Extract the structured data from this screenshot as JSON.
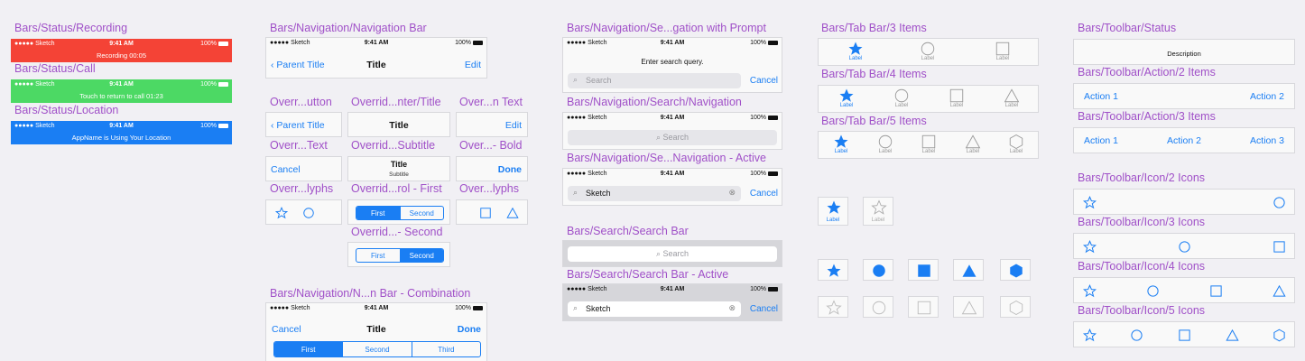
{
  "colors": {
    "label_purple": "#a050c8",
    "ios_blue": "#1a7ef3",
    "recording_red": "#f44336",
    "call_green": "#4cd964",
    "location_blue": "#1a7ef3"
  },
  "statusbar": {
    "carrier": "●●●●● Sketch",
    "time": "9:41 AM",
    "battery": "100%"
  },
  "col1": {
    "recording_label": "Bars/Status/Recording",
    "recording_text": "Recording  00:05",
    "call_label": "Bars/Status/Call",
    "call_text": "Touch to return to call  01:23",
    "location_label": "Bars/Status/Location",
    "location_text": "AppName is Using Your Location"
  },
  "col2": {
    "navbar_label": "Bars/Navigation/Navigation Bar",
    "parent_title": "Parent Title",
    "title": "Title",
    "edit": "Edit",
    "ov_button_label": "Overr...utton",
    "ov_center_label": "Overrid...nter/Title",
    "ov_ntext_label": "Over...n Text",
    "ov_text_label": "Overr...Text",
    "ov_subtitle_label": "Overrid...Subtitle",
    "ov_bold_label": "Over...- Bold",
    "cancel": "Cancel",
    "subtitle": "Subtitle",
    "done": "Done",
    "ov_glyphs_label": "Overr...lyphs",
    "ov_first_label": "Overrid...rol - First",
    "ov_glyphs2_label": "Over...lyphs",
    "ov_second_label": "Overrid...- Second",
    "first": "First",
    "second": "Second",
    "third": "Third",
    "combo_label": "Bars/Navigation/N...n Bar - Combination"
  },
  "col3": {
    "prompt_label": "Bars/Navigation/Se...gation with Prompt",
    "prompt_text": "Enter search query.",
    "search_placeholder": "Search",
    "cancel": "Cancel",
    "search_nav_label": "Bars/Navigation/Search/Navigation",
    "search_active_label": "Bars/Navigation/Se...Navigation - Active",
    "typed": "Sketch",
    "searchbar_label": "Bars/Search/Search Bar",
    "searchbar_active_label": "Bars/Search/Search Bar - Active"
  },
  "col4": {
    "tab3_label": "Bars/Tab Bar/3 Items",
    "tab4_label": "Bars/Tab Bar/4 Items",
    "tab5_label": "Bars/Tab Bar/5 Items",
    "tab_item": "Label"
  },
  "col5": {
    "status_label": "Bars/Toolbar/Status",
    "description": "Description",
    "action2_label": "Bars/Toolbar/Action/2 Items",
    "action3_label": "Bars/Toolbar/Action/3 Items",
    "action1": "Action 1",
    "action2": "Action 2",
    "action3": "Action 3",
    "icon2_label": "Bars/Toolbar/Icon/2 Icons",
    "icon3_label": "Bars/Toolbar/Icon/3 Icons",
    "icon4_label": "Bars/Toolbar/Icon/4 Icons",
    "icon5_label": "Bars/Toolbar/Icon/5 Icons"
  }
}
